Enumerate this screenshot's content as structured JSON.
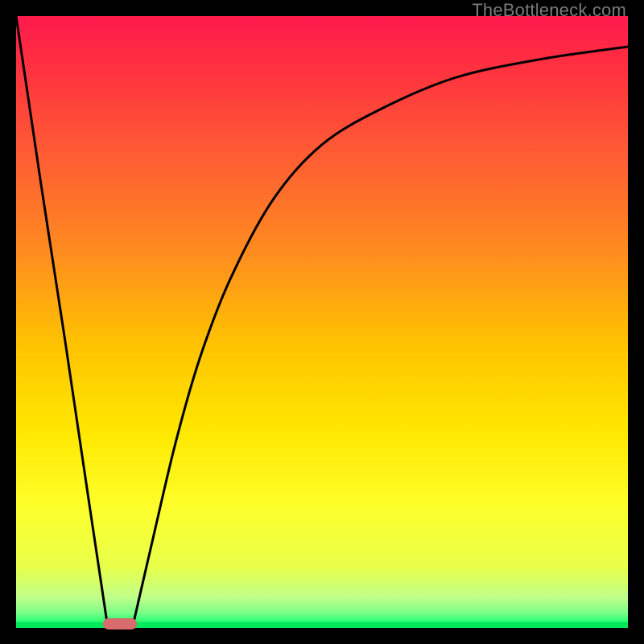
{
  "watermark": "TheBottleneck.com",
  "colors": {
    "frame": "#000000",
    "gradient_top": "#ff1a4d",
    "gradient_mid": "#ffe800",
    "gradient_bottom": "#00e85a",
    "curve": "#000000",
    "pill": "#d86b6b"
  },
  "chart_data": {
    "type": "line",
    "title": "",
    "xlabel": "",
    "ylabel": "",
    "xlim": [
      0,
      100
    ],
    "ylim": [
      0,
      100
    ],
    "grid": false,
    "legend": false,
    "series": [
      {
        "name": "left-branch",
        "x": [
          0,
          4,
          8,
          12,
          15
        ],
        "values": [
          100,
          73,
          47,
          20,
          0
        ]
      },
      {
        "name": "right-branch",
        "x": [
          19,
          22,
          26,
          30,
          35,
          42,
          50,
          60,
          72,
          86,
          100
        ],
        "values": [
          0,
          13,
          30,
          44,
          57,
          70,
          79,
          85,
          90,
          93,
          95
        ]
      }
    ],
    "markers": [
      {
        "name": "optimal-pill",
        "x": 17,
        "y": 0.7,
        "width_pct": 5.5,
        "height_pct": 1.8
      }
    ]
  }
}
